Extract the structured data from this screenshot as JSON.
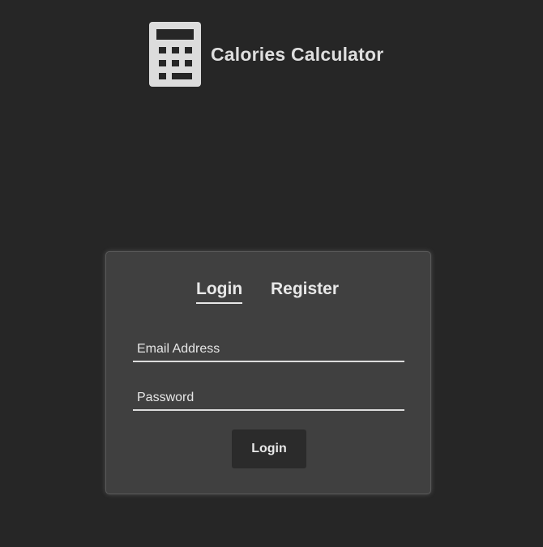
{
  "app": {
    "title": "Calories Calculator",
    "logo_icon": "calculator-icon"
  },
  "auth": {
    "tabs": [
      {
        "label": "Login",
        "active": true
      },
      {
        "label": "Register",
        "active": false
      }
    ],
    "email": {
      "placeholder": "Email Address",
      "value": ""
    },
    "password": {
      "placeholder": "Password",
      "value": ""
    },
    "submit_label": "Login"
  },
  "colors": {
    "background": "#262626",
    "card": "#404040",
    "button": "#2b2b2b",
    "text": "#e6e6e6"
  }
}
